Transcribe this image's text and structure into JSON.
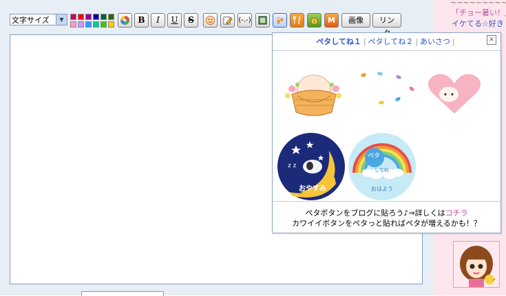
{
  "toolbar": {
    "font_size_select": "文字サイズ",
    "bold_label": "B",
    "italic_label": "I",
    "underline_label": "U",
    "strike_label": "S",
    "image_button": "画像",
    "link_button": "リンク",
    "swatch_colors": [
      "#cc0066",
      "#ff0000",
      "#990099",
      "#000099",
      "#006633",
      "#336600",
      "#ff99cc",
      "#cc99ff",
      "#3399ff",
      "#00cc99",
      "#33cc00",
      "#ffcc00"
    ]
  },
  "popup": {
    "tabs": [
      {
        "label": "ペタしてね１",
        "active": true
      },
      {
        "label": "ペタしてね２",
        "active": false
      },
      {
        "label": "あいさつ",
        "active": false
      }
    ],
    "close_label": "×",
    "stamps": {
      "goodnight_text": "おやすみ",
      "peta_text": "ペタ",
      "shitene_text": "してね",
      "morning_text": "おはよう"
    },
    "footer_line1_prefix": "ペタボタンをブログに貼ろう♪⇒詳しくは",
    "footer_link": "コチラ",
    "footer_line2": "カワイイボタンをペタっと貼ればペタが増えるかも！？"
  },
  "sidebar": {
    "line1": "「チョー暑い！」",
    "line2": "イケてる☆好き"
  }
}
